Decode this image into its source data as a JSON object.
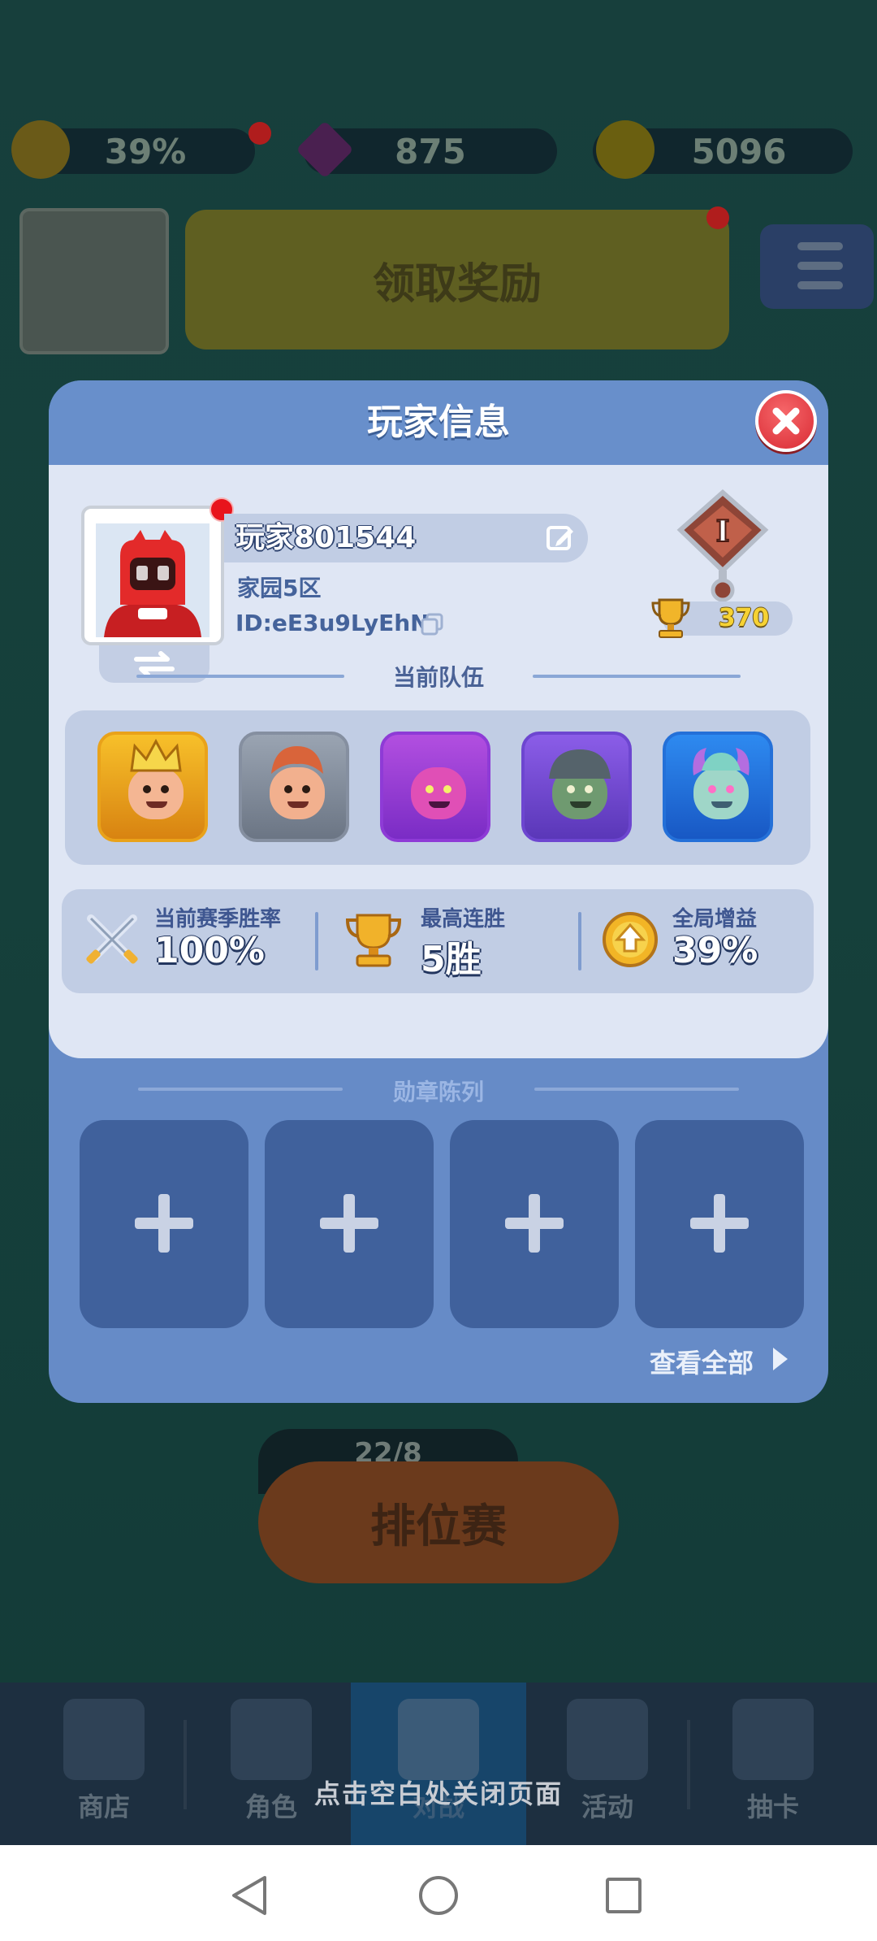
{
  "top_resources": {
    "boost_value": "39%",
    "gems": "875",
    "coins": "5096"
  },
  "claim_button": "领取奖励",
  "modal": {
    "title": "玩家信息",
    "player_name": "玩家801544",
    "server": "家园5区",
    "player_id": "ID:eE3u9LyEhN",
    "trophies": "370",
    "rank_letter": "I",
    "team_section": "当前队伍",
    "stats": [
      {
        "label": "当前赛季胜率",
        "value": "100%",
        "icon": "crossed-swords-icon"
      },
      {
        "label": "最高连胜",
        "value": "5胜",
        "icon": "trophy-icon"
      },
      {
        "label": "全局增益",
        "value": "39%",
        "icon": "boost-medal-icon"
      }
    ],
    "medal_section": "勋章陈列",
    "view_all": "查看全部"
  },
  "ranked": {
    "counter": "22/8",
    "button": "排位赛"
  },
  "bottom_nav": [
    {
      "label": "商店"
    },
    {
      "label": "角色"
    },
    {
      "label": "对战"
    },
    {
      "label": "活动"
    },
    {
      "label": "抽卡"
    }
  ],
  "close_hint": "点击空白处关闭页面",
  "colors": {
    "modal_blue": "#668bc7",
    "panel": "#dfe6f4",
    "close_red": "#d92b34",
    "trophy_gold": "#f6d233"
  }
}
